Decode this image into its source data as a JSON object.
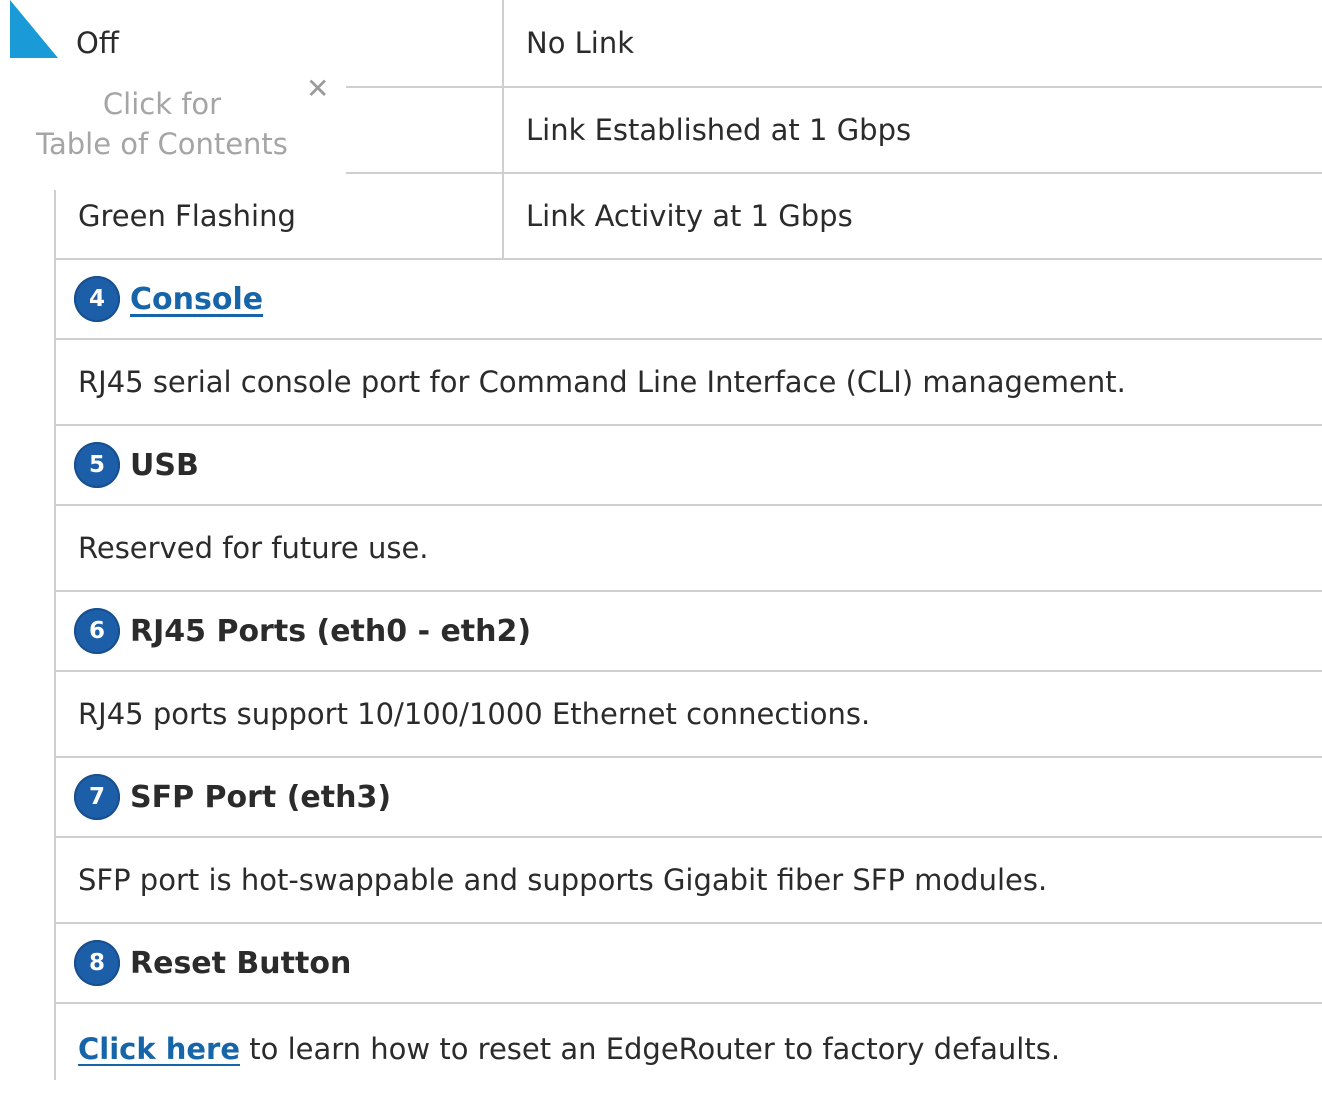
{
  "led_table": {
    "rows": [
      {
        "state": "Off",
        "status": "No Link"
      },
      {
        "state": "",
        "status": "Link Established at 1 Gbps"
      },
      {
        "state": "Green Flashing",
        "status": "Link Activity at 1 Gbps"
      }
    ]
  },
  "sections": [
    {
      "number": "4",
      "title": "Console",
      "title_is_link": true,
      "description": "RJ45 serial console port for Command Line Interface (CLI) management."
    },
    {
      "number": "5",
      "title": "USB",
      "description": "Reserved for future use."
    },
    {
      "number": "6",
      "title": "RJ45 Ports (eth0 - eth2)",
      "description": "RJ45 ports support 10/100/1000 Ethernet connections."
    },
    {
      "number": "7",
      "title": "SFP Port (eth3)",
      "description": "SFP port is hot-swappable and supports Gigabit fiber SFP modules."
    },
    {
      "number": "8",
      "title": "Reset Button",
      "description_link": "Click here",
      "description_rest": " to learn how to reset an EdgeRouter to factory defaults."
    }
  ],
  "toc": {
    "line1": "Click for",
    "line2": "Table of Contents",
    "close_icon": "close-icon",
    "corner_icon": "toc-corner-triangle-icon"
  },
  "colors": {
    "accent_blue": "#1d5ea8",
    "link_blue": "#1665a8",
    "corner_blue": "#1a9ad6",
    "grid_gray": "#cfcfcf",
    "toc_gray": "#a5a5a5"
  }
}
